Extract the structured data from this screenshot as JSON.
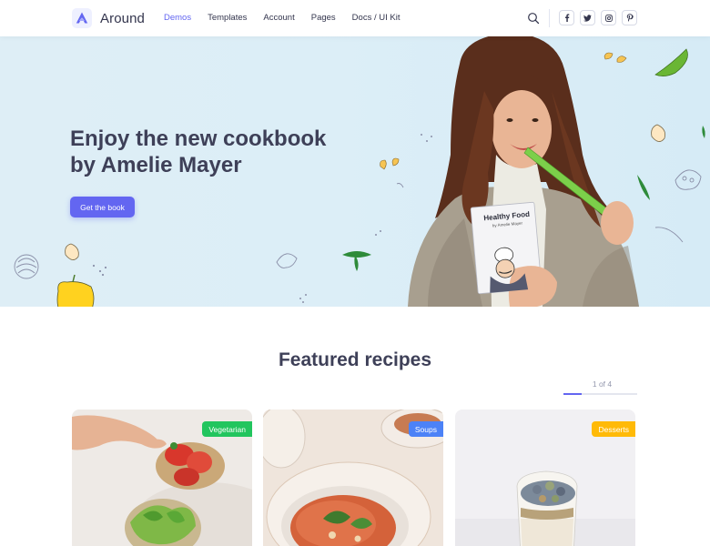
{
  "brand": {
    "name": "Around"
  },
  "nav": {
    "links": [
      {
        "label": "Demos",
        "active": true
      },
      {
        "label": "Templates",
        "active": false
      },
      {
        "label": "Account",
        "active": false
      },
      {
        "label": "Pages",
        "active": false
      },
      {
        "label": "Docs / UI Kit",
        "active": false
      }
    ],
    "socials": [
      "f",
      "t",
      "ig",
      "p"
    ]
  },
  "hero": {
    "title_line1": "Enjoy the new cookbook",
    "title_line2": "by Amelie Mayer",
    "cta_label": "Get the book",
    "book_title": "Healthy Food",
    "book_author": "by Amelie Mayer"
  },
  "featured": {
    "title": "Featured recipes",
    "pager": "1 of 4",
    "progress": 0.25,
    "cards": [
      {
        "badge": "Vegetarian",
        "badge_color": "#22c55e"
      },
      {
        "badge": "Soups",
        "badge_color": "#4c82f7"
      },
      {
        "badge": "Desserts",
        "badge_color": "#ffba08"
      }
    ]
  },
  "colors": {
    "accent": "#6366f1",
    "hero_bg": "#dceef7",
    "text": "#33354d"
  }
}
